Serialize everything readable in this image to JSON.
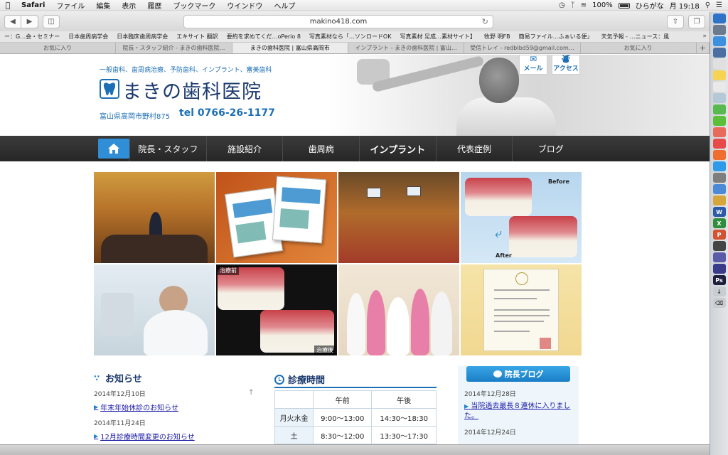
{
  "menubar": {
    "app": "Safari",
    "items": [
      "ファイル",
      "編集",
      "表示",
      "履歴",
      "ブックマーク",
      "ウインドウ",
      "ヘルプ"
    ],
    "battery": "100%",
    "ime": "ひらがな",
    "clock": "月 19:18"
  },
  "toolbar": {
    "url": "makino418.com"
  },
  "bookmarks": [
    "ー：G…会・セミナー",
    "日本歯周病学会",
    "日本臨床歯周病学会",
    "エキサイト 翻訳",
    "要約を求めてくだ…oPerio 8",
    "写真素材なら「…ソンロードOK",
    "写真素材 足成…素材サイト】",
    "牧野 明FB",
    "簡易ファイル…ふぁいる便」",
    "天気予報 - …ニュース：風"
  ],
  "tabs": [
    {
      "label": "お気に入り",
      "active": false
    },
    {
      "label": "院長・スタッフ紹介 - まきの歯科医院…",
      "active": false
    },
    {
      "label": "まきの歯科医院 | 富山県高岡市",
      "active": true
    },
    {
      "label": "インプラント - まきの歯科医院 | 富山…",
      "active": false
    },
    {
      "label": "受信トレイ - redblbd59@gmail.com…",
      "active": false
    },
    {
      "label": "お気に入り",
      "active": false
    }
  ],
  "header": {
    "tagline": "一般歯科、歯周病治療、予防歯科、インプラント、審美歯科",
    "clinic_name": "まきの歯科医院",
    "address": "富山県高岡市野村875",
    "tel": "tel 0766-26-1177",
    "mail_label": "メール",
    "access_label": "アクセス"
  },
  "nav": {
    "home_icon": "home-icon",
    "items": [
      "院長・スタッフ",
      "施設紹介",
      "歯周病",
      "インプラント",
      "代表症例",
      "ブログ"
    ]
  },
  "gallery": {
    "before_label": "Before",
    "after_label": "After",
    "pre_treatment": "治療前",
    "post_treatment": "治療後"
  },
  "news": {
    "title": "お知らせ",
    "items": [
      {
        "date": "2014年12月10日",
        "text": "年末年始休診のお知らせ"
      },
      {
        "date": "2014年11月24日",
        "text": "12月診療時間変更のお知らせ"
      }
    ]
  },
  "hours": {
    "title": "診療時間",
    "head": [
      "",
      "午前",
      "午後"
    ],
    "rows": [
      [
        "月火水金",
        "9:00～13:00",
        "14:30～18:30"
      ],
      [
        "土",
        "8:30～12:00",
        "13:30～17:30"
      ]
    ]
  },
  "blog": {
    "button": "院長ブログ",
    "items": [
      {
        "date": "2014年12月28日",
        "text": "当院過去最長８連休に入りました。"
      },
      {
        "date": "2014年12月24日",
        "text": ""
      }
    ]
  },
  "colors": {
    "brand_blue": "#1d6fb5",
    "nav_bg": "#2e2e2e",
    "home_btn": "#2f8ed6",
    "blog_btn": "#1b7ec6",
    "link": "#1a1aa6"
  }
}
